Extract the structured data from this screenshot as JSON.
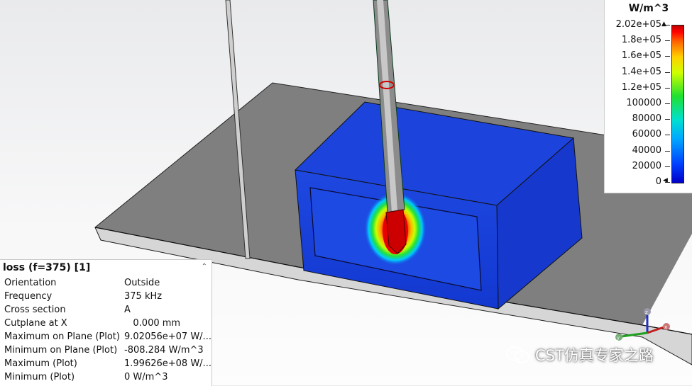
{
  "legend": {
    "unit": "W/m^3",
    "ticks": [
      "2.02e+05",
      "1.8e+05",
      "1.6e+05",
      "1.4e+05",
      "1.2e+05",
      "100000",
      "80000",
      "60000",
      "40000",
      "20000",
      "0"
    ],
    "max_value": 202000,
    "min_value": 0,
    "colors": [
      "#0000c8",
      "#00a8ff",
      "#20e030",
      "#ffd000",
      "#ff0000",
      "#c00000"
    ]
  },
  "info_panel": {
    "title": "loss (f=375) [1]",
    "rows": [
      {
        "key": "Orientation",
        "value": "Outside"
      },
      {
        "key": "Frequency",
        "value": "375 kHz"
      },
      {
        "key": "Cross section",
        "value": "A"
      },
      {
        "key": "Cutplane at X",
        "value": "   0.000 mm"
      },
      {
        "key": "Maximum on Plane (Plot)",
        "value": "9.02056e+07 W/..."
      },
      {
        "key": "Minimum on Plane (Plot)",
        "value": "-808.284 W/m^3"
      },
      {
        "key": "Maximum (Plot)",
        "value": "1.99626e+08 W/..."
      },
      {
        "key": "Minimum (Plot)",
        "value": "0 W/m^3"
      }
    ]
  },
  "axes": {
    "x": "x",
    "y": "y",
    "z": "z"
  },
  "watermark": "CST仿真专家之路",
  "colors": {
    "plate": "#808080",
    "box_blue": "#1a3ed8",
    "hot": "#e00000",
    "probe": "#9a9a9a"
  }
}
